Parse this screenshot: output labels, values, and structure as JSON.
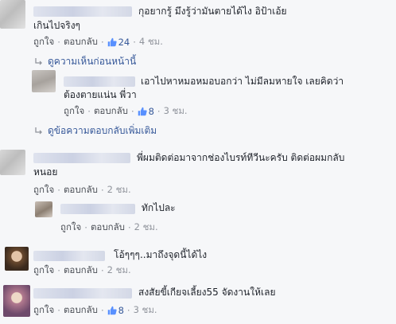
{
  "comments": [
    {
      "text_line1": "กุอยากรู้ มึงรู้ว่ามันตายได้ไง อิป้าเอ้ย",
      "text_line2": "เกินไปจริงๆ",
      "like_label": "ถูกใจ",
      "reply_label": "ตอบกลับ",
      "likes": "24",
      "time": "4 ชม."
    },
    {
      "view_more": "ดูความเห็นก่อนหน้านี้"
    },
    {
      "text_line1": "เอาไปหาหมอหมอบอกว่า ไม่มีลมหายใจ เลยคิดว่า",
      "text_line2": "ต้องตายแน่น พี่วา",
      "like_label": "ถูกใจ",
      "reply_label": "ตอบกลับ",
      "likes": "8",
      "time": "3 ชม."
    },
    {
      "view_more": "ดูข้อความตอบกลับเพิ่มเติม"
    },
    {
      "text_line1": "พี่ผมติดต่อมาจากช่องไบรท์ทีวีนะครับ ติดต่อผมกลับ",
      "text_line2": "หนอย",
      "like_label": "ถูกใจ",
      "reply_label": "ตอบกลับ",
      "time": "2 ชม."
    },
    {
      "text_line1": "ทักไปละ",
      "like_label": "ถูกใจ",
      "reply_label": "ตอบกลับ",
      "time": "2 ชม."
    },
    {
      "text_line1": "โอ้ๆๆๆ..มาถึงจุดนี้ได้ไง",
      "like_label": "ถูกใจ",
      "reply_label": "ตอบกลับ",
      "time": "2 ชม."
    },
    {
      "text_line1": "สงสัยขี้เกียจเลี้ยง55 จัดงานให้เลย",
      "like_label": "ถูกใจ",
      "reply_label": "ตอบกลับ",
      "likes": "8",
      "time": "3 ชม."
    }
  ],
  "icons": {
    "like": "thumbs-up-icon",
    "reply_arrow": "reply-arrow-icon"
  },
  "colors": {
    "link": "#365899",
    "meta": "#90949c",
    "text": "#1d2129",
    "background": "#f6f7f9"
  }
}
